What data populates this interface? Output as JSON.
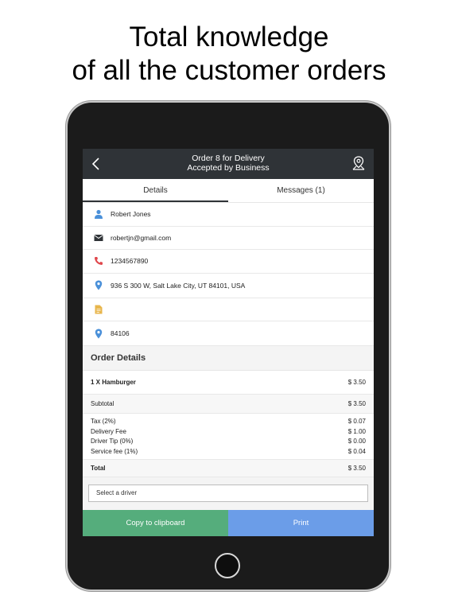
{
  "headline": {
    "line1": "Total knowledge",
    "line2": "of all the customer orders"
  },
  "navbar": {
    "title_line1": "Order 8 for Delivery",
    "title_line2": "Accepted by Business",
    "back_icon": "chevron-left-icon",
    "map_icon": "map-pin-icon"
  },
  "tabs": [
    {
      "label": "Details",
      "active": true
    },
    {
      "label": "Messages (1)",
      "active": false
    }
  ],
  "customer": {
    "name": "Robert Jones",
    "email": "robertjn@gmail.com",
    "phone": "1234567890",
    "address": "936 S 300 W, Salt Lake City, UT 84101, USA",
    "note": "",
    "zip": "84106"
  },
  "order_details": {
    "title": "Order Details",
    "items": [
      {
        "label": "1 X Hamburger",
        "amount": "$ 3.50"
      }
    ],
    "subtotal": {
      "label": "Subtotal",
      "amount": "$ 3.50"
    },
    "fees": [
      {
        "label": "Tax (2%)",
        "amount": "$ 0.07"
      },
      {
        "label": "Delivery Fee",
        "amount": "$ 1.00"
      },
      {
        "label": "Driver Tip (0%)",
        "amount": "$ 0.00"
      },
      {
        "label": "Service fee (1%)",
        "amount": "$ 0.04"
      }
    ],
    "total": {
      "label": "Total",
      "amount": "$ 3.50"
    }
  },
  "driver_select": {
    "placeholder": "Select a driver"
  },
  "actions": {
    "copy_label": "Copy to clipboard",
    "print_label": "Print"
  },
  "colors": {
    "navbar": "#2f3337",
    "copy_button": "#55ad7c",
    "print_button": "#6b9de8",
    "person_icon": "#4a90d9",
    "phone_icon": "#e0474c",
    "note_icon": "#e8b64c",
    "pin_icon": "#4a90d9"
  }
}
